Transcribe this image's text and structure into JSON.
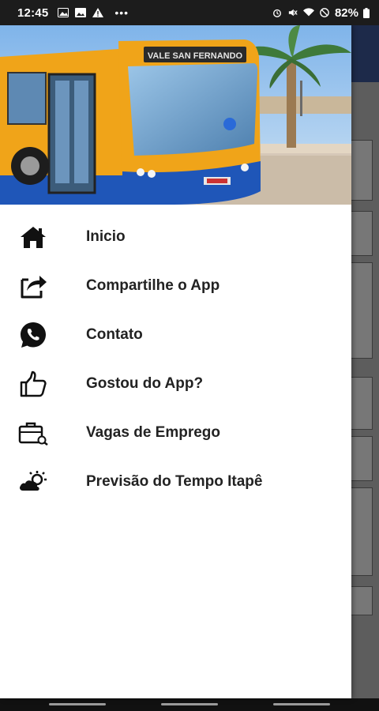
{
  "status_bar": {
    "time": "12:45",
    "battery": "82%",
    "left_icons": [
      "image-icon",
      "gallery-icon",
      "warning-icon",
      "more-dots-icon"
    ],
    "right_icons": [
      "alarm-icon",
      "mute-icon",
      "wifi-icon",
      "dnd-icon",
      "battery-icon"
    ]
  },
  "drawer": {
    "header_image": {
      "bus_destination_sign": "VALE SAN FERNANDO"
    },
    "menu": [
      {
        "label": "Inicio",
        "icon": "home-icon"
      },
      {
        "label": "Compartilhe o App",
        "icon": "share-icon"
      },
      {
        "label": "Contato",
        "icon": "whatsapp-icon"
      },
      {
        "label": "Gostou do App?",
        "icon": "thumbs-up-icon"
      },
      {
        "label": "Vagas de Emprego",
        "icon": "briefcase-icon"
      },
      {
        "label": "Previsão do Tempo Itapê",
        "icon": "weather-icon"
      }
    ]
  },
  "colors": {
    "drawer_bg": "#ffffff",
    "scrim": "#5d5d5d",
    "background_header": "#1d2a4a",
    "bus_yellow": "#f0a419",
    "bus_blue": "#1f56b8",
    "menu_text": "#222222"
  }
}
